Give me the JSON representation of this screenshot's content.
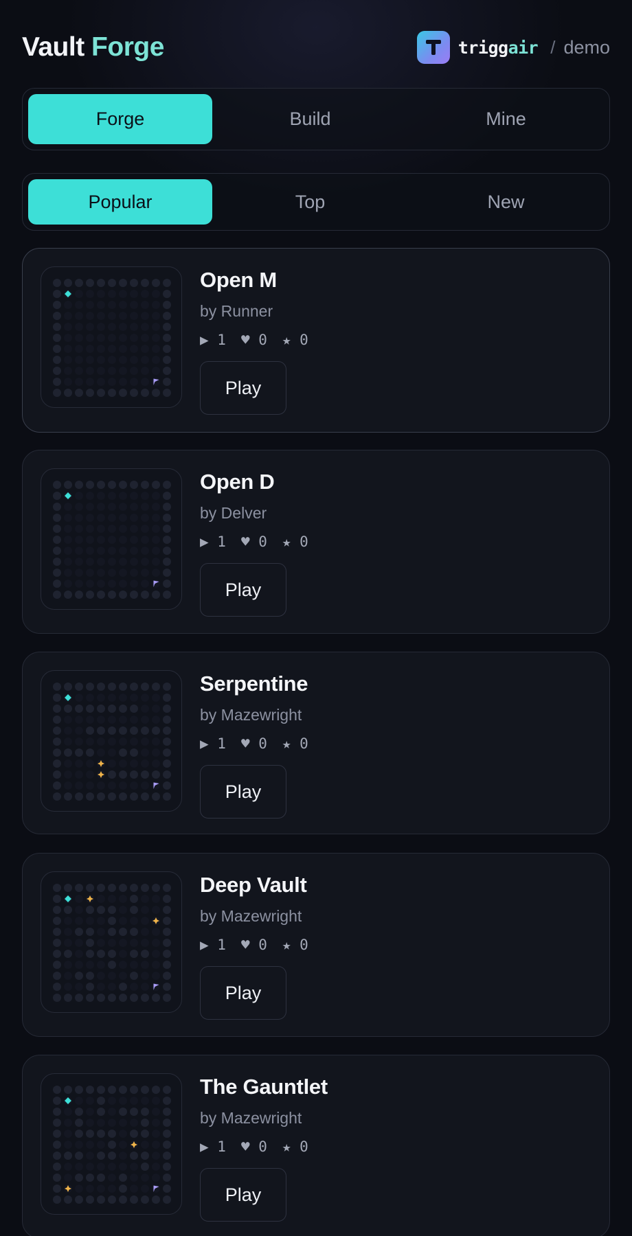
{
  "header": {
    "title_part1": "Vault",
    "title_part2": "Forge",
    "brand_part1": "trigg",
    "brand_part2": "air",
    "brand_separator": "/",
    "brand_context": "demo",
    "logo_icon": "t-logo-icon"
  },
  "mode_tabs": [
    {
      "label": "Forge",
      "active": true
    },
    {
      "label": "Build",
      "active": false
    },
    {
      "label": "Mine",
      "active": false
    }
  ],
  "sort_tabs": [
    {
      "label": "Popular",
      "active": true
    },
    {
      "label": "Top",
      "active": false
    },
    {
      "label": "New",
      "active": false
    }
  ],
  "colors": {
    "accent": "#3ddfd7",
    "title_accent": "#7de3d6",
    "start_marker": "#3ddfd7",
    "gem_marker": "#f0b44a",
    "exit_flag": "#a99cf6",
    "wall_dot": "#1f2330",
    "floor_dot": "#141722"
  },
  "levels": [
    {
      "title": "Open M",
      "author": "by Runner",
      "plays": "▶ 1",
      "likes": "♥ 0",
      "stars": "★ 0",
      "play_label": "Play",
      "map": [
        "WWWWWWWWWWW",
        "WSFFFFFFFFW",
        "WFFFFFFFFFW",
        "WFFFFFFFFFW",
        "WFFFFFFFFFW",
        "WFFFFFFFFFW",
        "WFFFFFFFFFW",
        "WFFFFFFFFFW",
        "WFFFFFFFFFW",
        "WFFFFFFFFEW",
        "WWWWWWWWWWW"
      ]
    },
    {
      "title": "Open D",
      "author": "by Delver",
      "plays": "▶ 1",
      "likes": "♥ 0",
      "stars": "★ 0",
      "play_label": "Play",
      "map": [
        "WWWWWWWWWWW",
        "WSFFFFFFFFW",
        "WFFFFFFFFFW",
        "WFFFFFFFFFW",
        "WFFFFFFFFFW",
        "WFFFFFFFFFW",
        "WFFFFFFFFFW",
        "WFFFFFFFFFW",
        "WFFFFFFFFFW",
        "WFFFFFFFFEW",
        "WWWWWWWWWWW"
      ]
    },
    {
      "title": "Serpentine",
      "author": "by Mazewright",
      "plays": "▶ 1",
      "likes": "♥ 0",
      "stars": "★ 0",
      "play_label": "Play",
      "map": [
        "WWWWWWWWWWW",
        "WSFFFFFFFFW",
        "WWWWWWWWFFW",
        "WFFFFFFFFFW",
        "WFFWWWWWWWW",
        "WFFFFFFFFFW",
        "WWWWFFWWFFW",
        "WFFFGFFFFFW",
        "WFFFGWWWWWW",
        "WFFFFFFFFEW",
        "WWWWWWWWWWW"
      ]
    },
    {
      "title": "Deep Vault",
      "author": "by Mazewright",
      "plays": "▶ 1",
      "likes": "♥ 0",
      "stars": "★ 0",
      "play_label": "Play",
      "map": [
        "WWWWWWWWWWW",
        "WSFGFFFWFFW",
        "WWFWWWFWFFW",
        "WFFFFWFFFGW",
        "WFWWFWWWFFW",
        "WFFWFFFFFFW",
        "WWFWWWFWWFW",
        "WFFFFWFFFFW",
        "WFWWFFFWFFW",
        "WFFWFFWFFEW",
        "WWWWWWWWWWW"
      ]
    },
    {
      "title": "The Gauntlet",
      "author": "by Mazewright",
      "plays": "▶ 1",
      "likes": "♥ 0",
      "stars": "★ 0",
      "play_label": "Play",
      "map": [
        "WWWWWWWWWWW",
        "WSFFWFFFFFW",
        "WFWFWFWWWFW",
        "WFWFFFFFWFW",
        "WFWWWWFWWFW",
        "WFFFFWFGFFW",
        "WWWFWWFWWFW",
        "WFFFFFFFWFW",
        "WFWWWFWFFFW",
        "WGFFFFWFFEW",
        "WWWWWWWWWWW"
      ]
    }
  ]
}
